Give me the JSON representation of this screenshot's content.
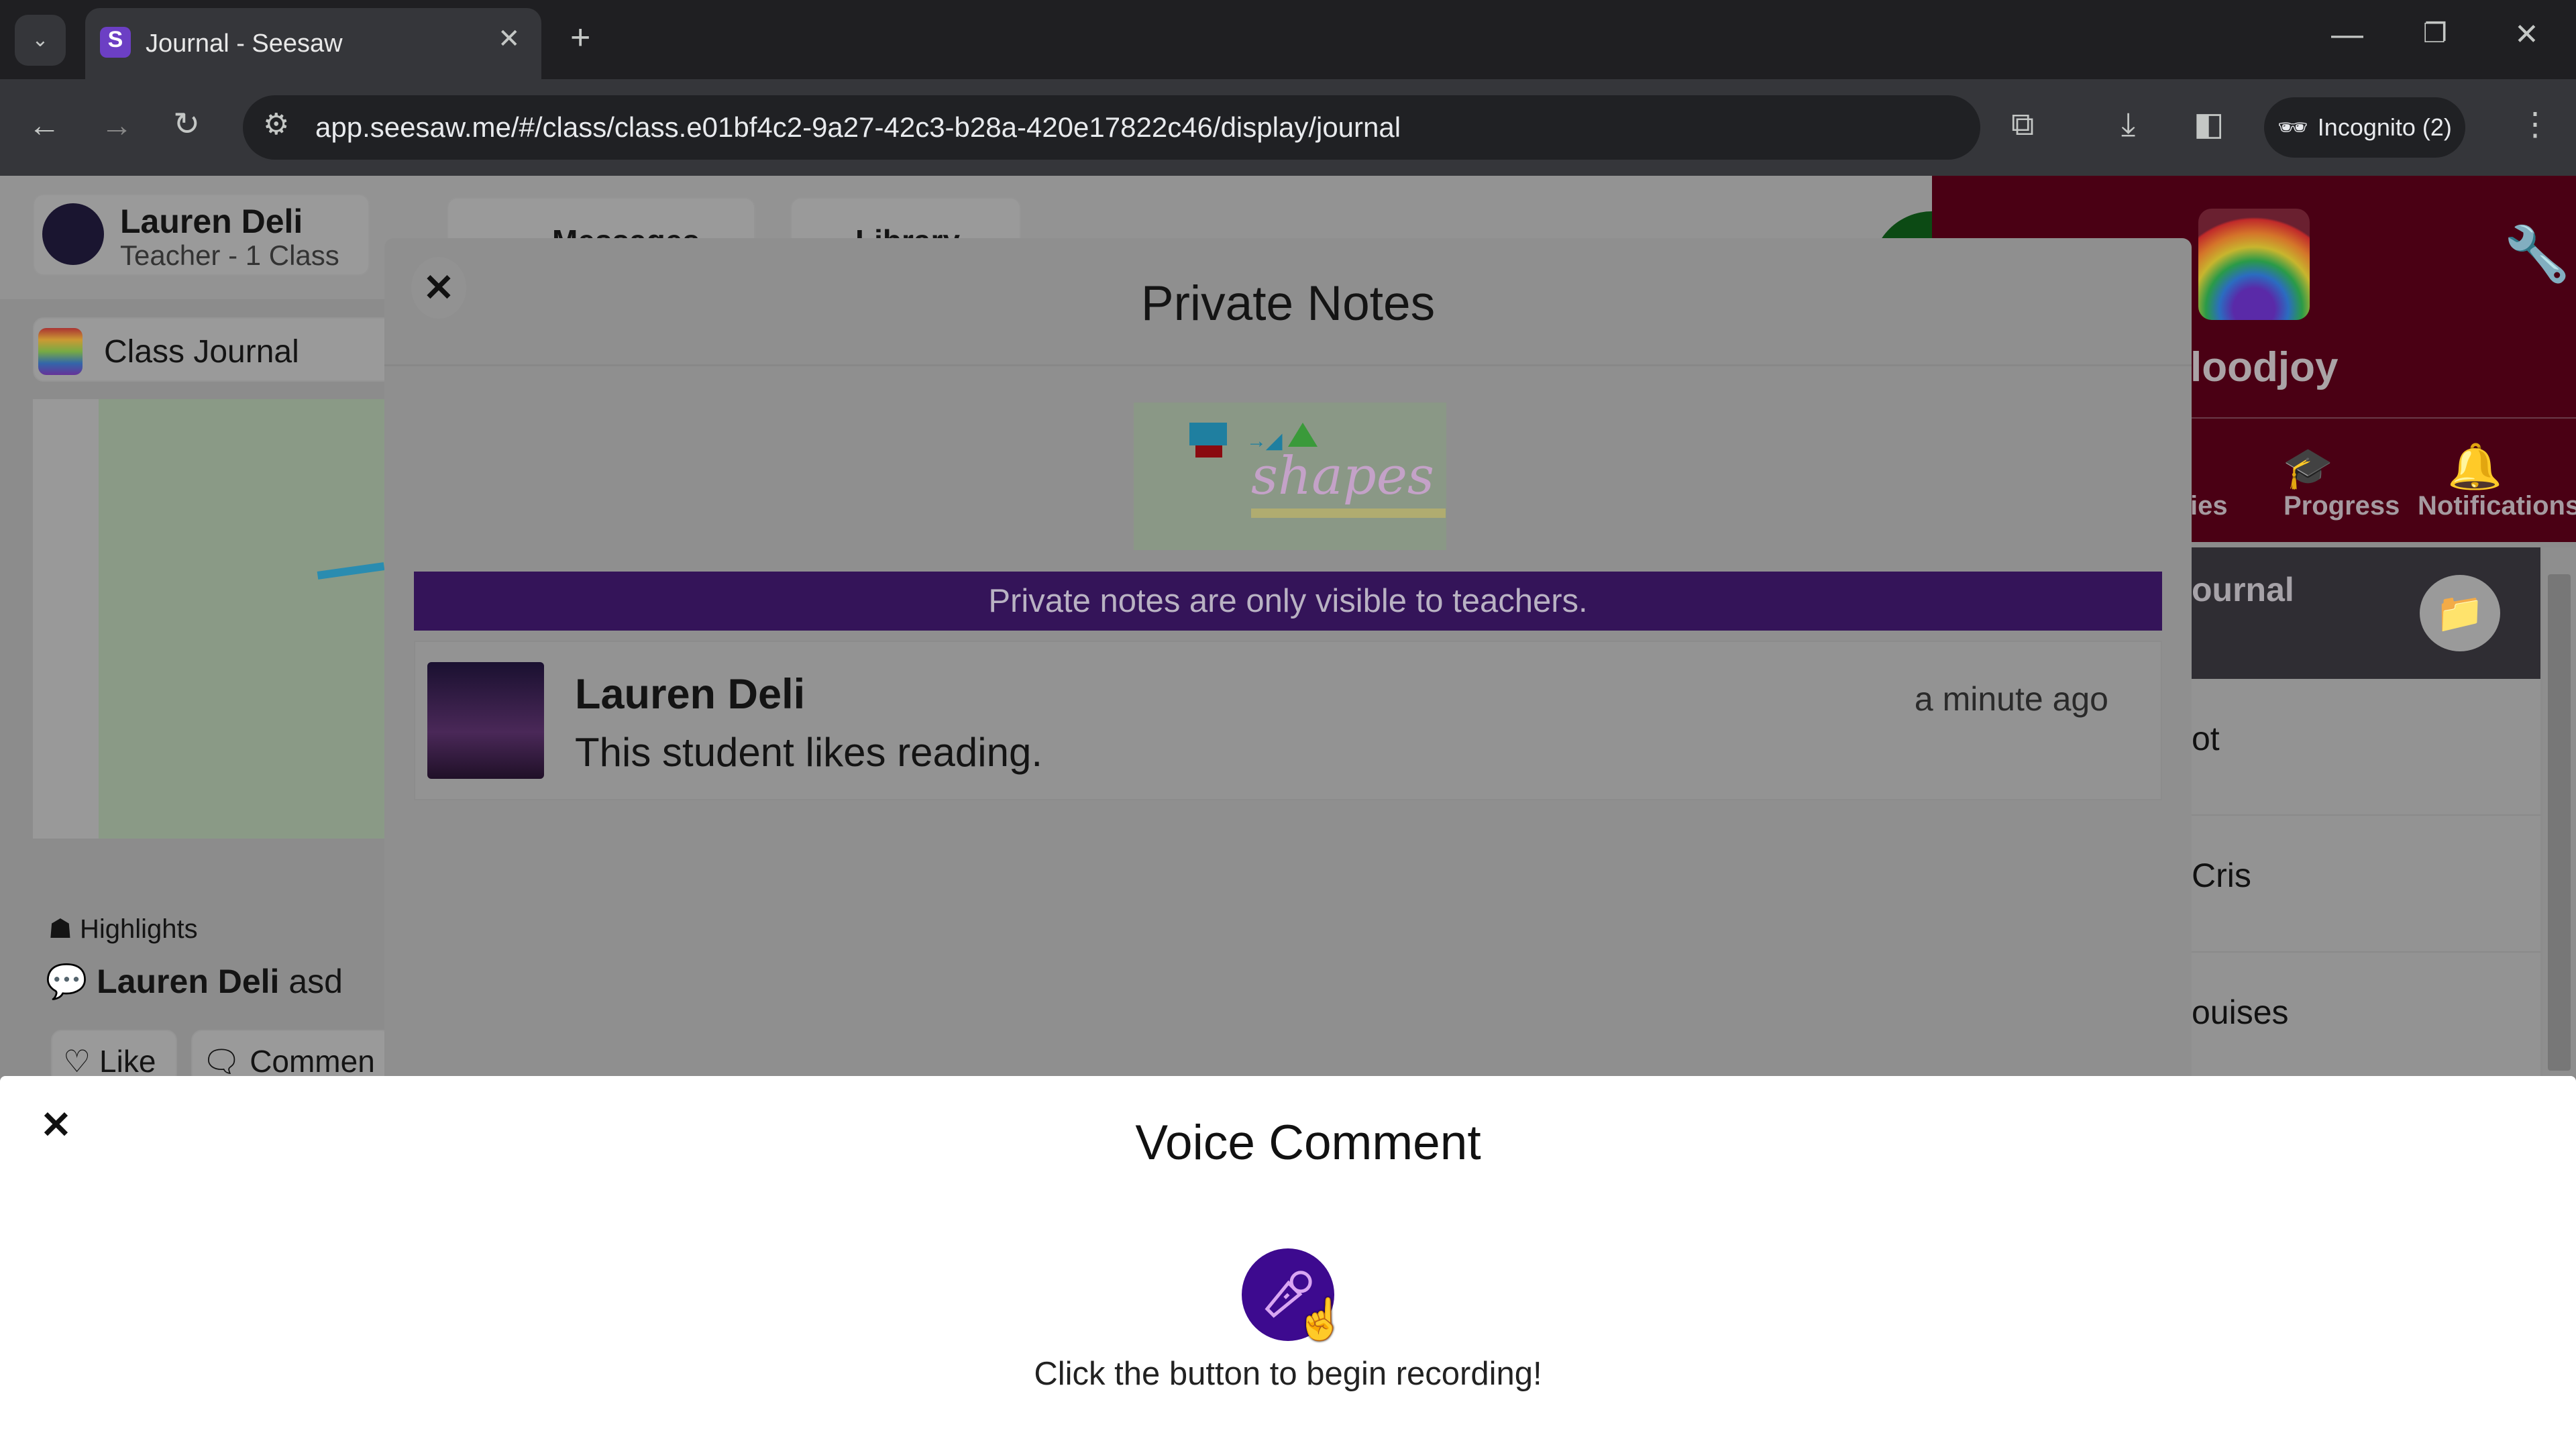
{
  "browser": {
    "tab_title": "Journal - Seesaw",
    "url": "app.seesaw.me/#/class/class.e01bf4c2-9a27-42c3-b28a-420e17822c46/display/journal",
    "incognito_label": "Incognito (2)"
  },
  "background": {
    "user": {
      "name": "Lauren Deli",
      "role": "Teacher - 1 Class"
    },
    "nav": {
      "messages": "Messages",
      "library": "Library"
    },
    "class_journal": "Class Journal",
    "post": {
      "highlights": "Highlights",
      "comment_author": "Lauren Deli",
      "comment_text": "asd",
      "like": "Like",
      "comment": "Commen"
    },
    "right": {
      "class_name_partial": "loodjoy",
      "tabs": [
        "ies",
        "Progress",
        "Notifications"
      ],
      "journal_partial": "ournal",
      "list": [
        "ot",
        "Cris",
        "ouises"
      ]
    }
  },
  "private_notes": {
    "title": "Private Notes",
    "image_caption": "shapes",
    "banner": "Private notes are only visible to teachers.",
    "notes": [
      {
        "author": "Lauren Deli",
        "text": "This student likes reading.",
        "time": "a minute ago"
      }
    ]
  },
  "voice_comment": {
    "title": "Voice Comment",
    "instruction": "Click the button to begin recording!"
  },
  "colors": {
    "banner": "#341459",
    "mic_button": "#3d0a8f",
    "class_header": "#4a0014"
  }
}
